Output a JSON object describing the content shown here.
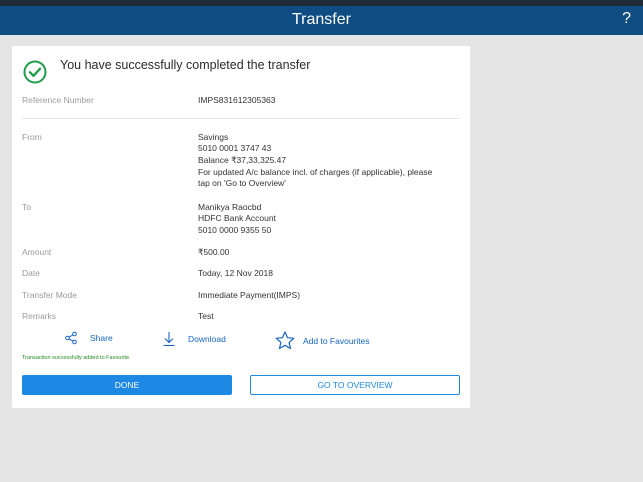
{
  "header": {
    "title": "Transfer",
    "help": "?"
  },
  "success": {
    "message": "You have successfully completed the transfer"
  },
  "reference": {
    "label": "Reference Number",
    "value": "IMPS831612305363"
  },
  "from": {
    "label": "From",
    "account_type": "Savings",
    "account_number": "5010 0001 3747 43",
    "balance": "Balance ₹37,33,325.47",
    "note_line1": "For updated A/c balance incl. of charges (if applicable), please",
    "note_line2": "tap on 'Go to Overview'"
  },
  "to": {
    "label": "To",
    "name": "Manikya Raocbd",
    "bank": "HDFC Bank Account",
    "account_number": "5010 0000 9355 50"
  },
  "amount": {
    "label": "Amount",
    "value": "₹500.00"
  },
  "date": {
    "label": "Date",
    "value": "Today, 12 Nov 2018"
  },
  "mode": {
    "label": "Transfer Mode",
    "value": "Immediate Payment(IMPS)"
  },
  "remarks": {
    "label": "Remarks",
    "value": "Test"
  },
  "actions": {
    "share": "Share",
    "download": "Download",
    "favourite": "Add to Favourites"
  },
  "favourite_note": "Transaction successfully added to Favourite.",
  "buttons": {
    "done": "DONE",
    "overview": "GO TO OVERVIEW"
  },
  "colors": {
    "header": "#0f4c81",
    "accent": "#1e88e5",
    "success": "#1e9e4a"
  }
}
